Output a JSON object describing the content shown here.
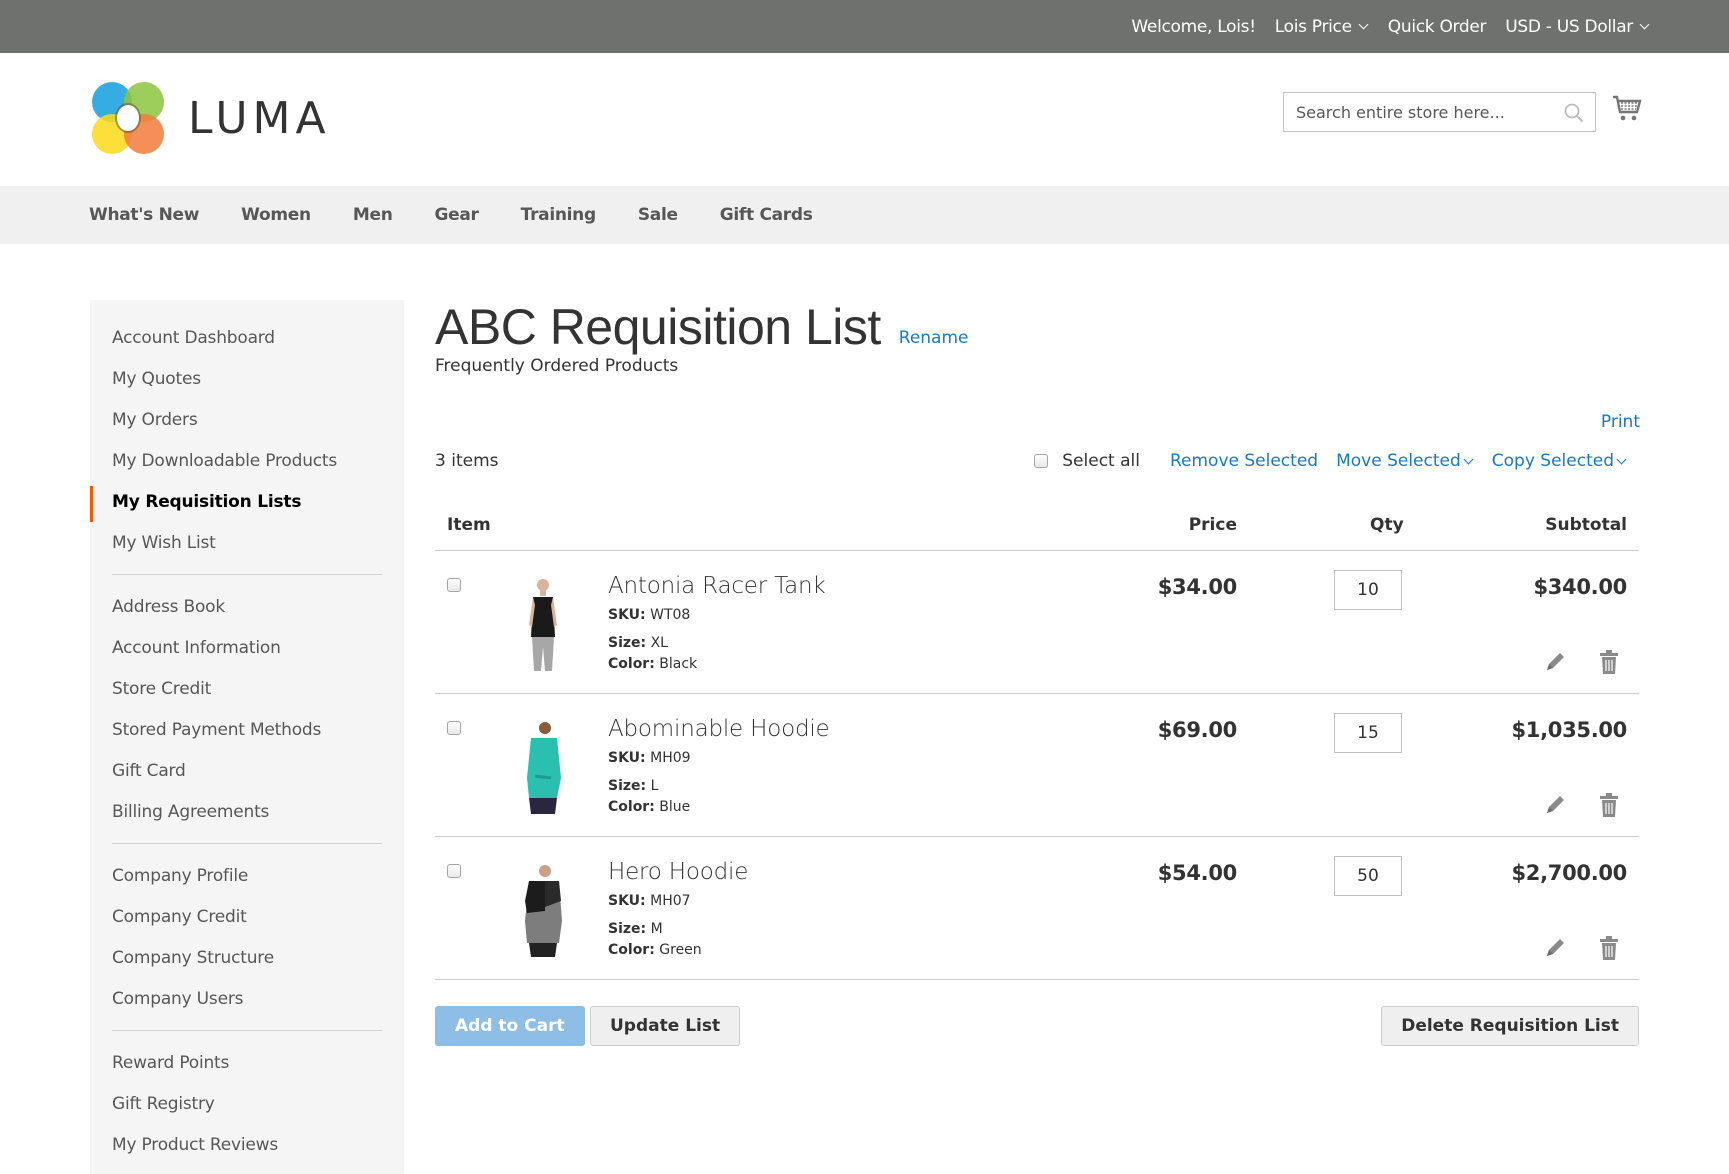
{
  "panel": {
    "welcome": "Welcome, Lois!",
    "customer_name": "Lois Price",
    "quick_order": "Quick Order",
    "currency": "USD - US Dollar"
  },
  "header": {
    "logo_text": "LUMA",
    "search_placeholder": "Search entire store here...",
    "search_value": ""
  },
  "nav": {
    "items": [
      "What's New",
      "Women",
      "Men",
      "Gear",
      "Training",
      "Sale",
      "Gift Cards"
    ]
  },
  "sidebar": {
    "groups": [
      [
        "Account Dashboard",
        "My Quotes",
        "My Orders",
        "My Downloadable Products",
        "My Requisition Lists",
        "My Wish List"
      ],
      [
        "Address Book",
        "Account Information",
        "Store Credit",
        "Stored Payment Methods",
        "Gift Card",
        "Billing Agreements"
      ],
      [
        "Company Profile",
        "Company Credit",
        "Company Structure",
        "Company Users"
      ],
      [
        "Reward Points",
        "Gift Registry",
        "My Product Reviews"
      ]
    ],
    "active": "My Requisition Lists",
    "active_color": "#ff5501"
  },
  "main": {
    "title": "ABC Requisition List",
    "rename": "Rename",
    "description": "Frequently Ordered Products",
    "print": "Print",
    "item_count": "3 items",
    "select_all": "Select all",
    "remove_selected": "Remove Selected",
    "move_selected": "Move Selected",
    "copy_selected": "Copy Selected",
    "link_color": "#1979c3"
  },
  "table": {
    "headers": {
      "item": "Item",
      "price": "Price",
      "qty": "Qty",
      "subtotal": "Subtotal"
    },
    "rows": [
      {
        "name": "Antonia Racer Tank",
        "sku_label": "SKU:",
        "sku": "WT08",
        "size_label": "Size:",
        "size": "XL",
        "color_label": "Color:",
        "color": "Black",
        "price": "$34.00",
        "qty": "10",
        "subtotal": "$340.00",
        "thumb": "black-tank"
      },
      {
        "name": "Abominable Hoodie",
        "sku_label": "SKU:",
        "sku": "MH09",
        "size_label": "Size:",
        "size": "L",
        "color_label": "Color:",
        "color": "Blue",
        "price": "$69.00",
        "qty": "15",
        "subtotal": "$1,035.00",
        "thumb": "teal-hoodie"
      },
      {
        "name": "Hero Hoodie",
        "sku_label": "SKU:",
        "sku": "MH07",
        "size_label": "Size:",
        "size": "M",
        "color_label": "Color:",
        "color": "Green",
        "price": "$54.00",
        "qty": "50",
        "subtotal": "$2,700.00",
        "thumb": "gray-hoodie"
      }
    ]
  },
  "buttons": {
    "add_to_cart": "Add to Cart",
    "update_list": "Update List",
    "delete_list": "Delete Requisition List"
  }
}
